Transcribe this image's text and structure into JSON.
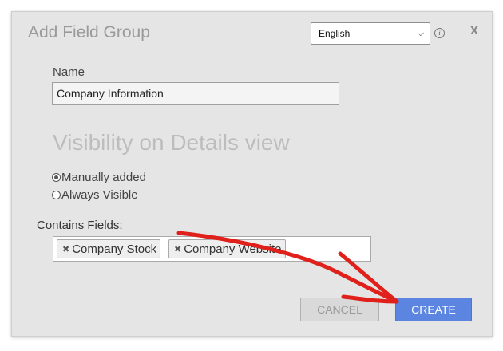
{
  "dialog": {
    "title": "Add Field Group",
    "language": {
      "selected": "English"
    },
    "close_label": "x"
  },
  "form": {
    "name_label": "Name",
    "name_value": "Company Information",
    "visibility_heading": "Visibility on Details view",
    "visibility_options": [
      {
        "label": "Manually added",
        "checked": true
      },
      {
        "label": "Always Visible",
        "checked": false
      }
    ],
    "fields_label": "Contains Fields:",
    "fields": [
      {
        "label": "Company Stock"
      },
      {
        "label": "Company Website"
      }
    ]
  },
  "buttons": {
    "cancel": "CANCEL",
    "create": "CREATE"
  },
  "colors": {
    "create_button": "#5b85e0",
    "annotation_arrow": "#e0201b"
  }
}
